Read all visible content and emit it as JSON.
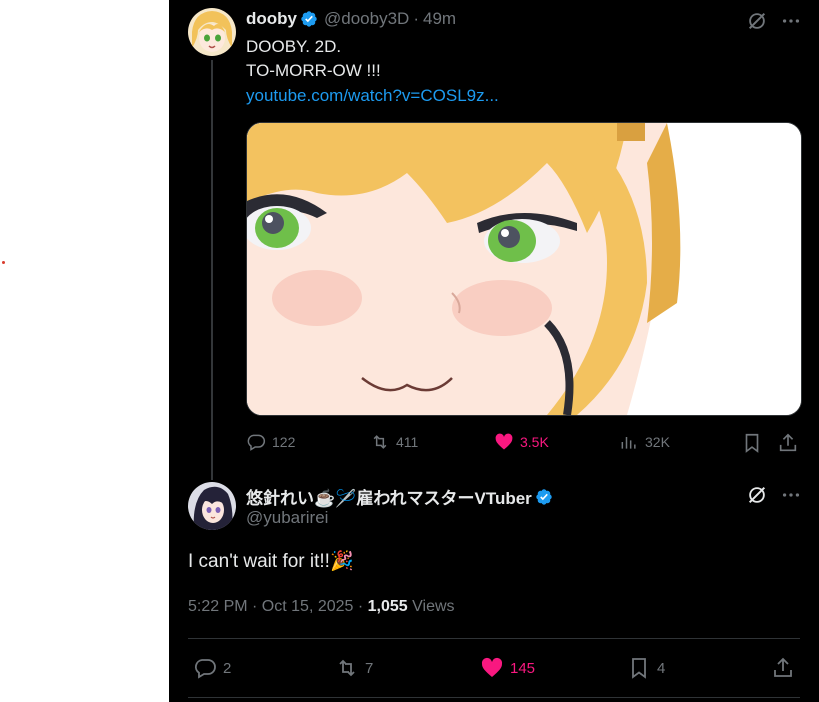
{
  "tweet1": {
    "name": "dooby",
    "handle": "@dooby3D",
    "sep": "·",
    "time": "49m",
    "line1": "DOOBY. 2D.",
    "line2": "TO-MORR-OW !!!",
    "link": "youtube.com/watch?v=COSL9z...",
    "replies": "122",
    "retweets": "411",
    "likes": "3.5K",
    "views": "32K"
  },
  "tweet2": {
    "name": "悠針れい☕🪡雇われマスターVTuber",
    "handle": "@yubarirei",
    "text": "I can't wait for it!!🎉",
    "timestamp": "5:22 PM · Oct 15, 2025 · ",
    "views_count": "1,055",
    "views_label": "Views",
    "replies": "2",
    "retweets": "7",
    "likes": "145",
    "bookmarks": "4"
  },
  "colors": {
    "accent": "#1d9bf0",
    "like": "#f91880",
    "muted": "#71767b",
    "text": "#e7e9ea",
    "background": "#000000"
  },
  "icons": [
    "verified-badge-icon",
    "grok-icon",
    "more-icon",
    "reply-icon",
    "retweet-icon",
    "heart-icon",
    "views-icon",
    "bookmark-icon",
    "share-icon"
  ]
}
